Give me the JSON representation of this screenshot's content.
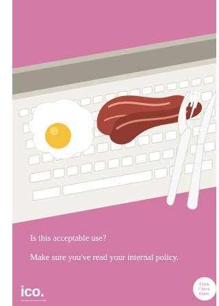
{
  "poster": {
    "question": "Is this acceptable use?",
    "message": "Make sure you've read your internal policy.",
    "logo": "ico.",
    "logo_tagline": "Information Commissioner's Office",
    "badge_lines": [
      "Think.",
      "Check.",
      "Share."
    ]
  },
  "illustration": {
    "items": [
      "keyboard",
      "fried-egg",
      "bacon",
      "fork",
      "knife"
    ]
  },
  "colors": {
    "background": "#d07aa4",
    "keyboard_body": "#f2f0ea",
    "keyboard_frame": "#a09a8c",
    "egg_yolk": "#f4c13c",
    "bacon": "#a8483a",
    "cutlery": "#f8f8f8",
    "text": "#ffffff"
  }
}
